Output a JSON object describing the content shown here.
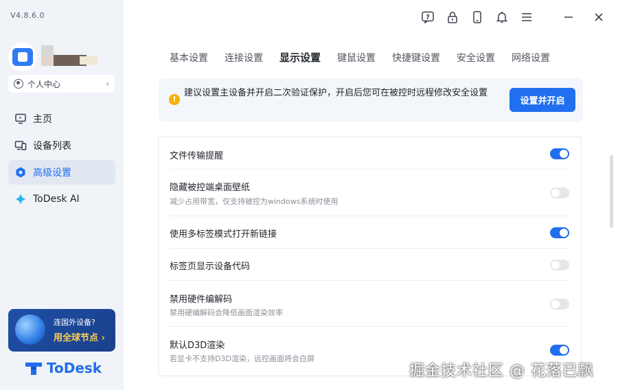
{
  "app": {
    "version": "V4.8.6.0",
    "brand": "ToDesk"
  },
  "sidebar": {
    "personal_center": "个人中心",
    "items": [
      {
        "label": "主页",
        "icon": "monitor-home-icon"
      },
      {
        "label": "设备列表",
        "icon": "devices-icon"
      },
      {
        "label": "高级设置",
        "icon": "gear-icon"
      },
      {
        "label": "ToDesk AI",
        "icon": "sparkle-icon"
      }
    ],
    "active_index": 2,
    "promo": {
      "line1": "连国外设备?",
      "line2": "用全球节点"
    }
  },
  "topbar": {
    "icons": [
      "help-icon",
      "lock-icon",
      "phone-icon",
      "bell-icon",
      "menu-icon"
    ],
    "window_controls": [
      "minimize-icon",
      "close-icon"
    ]
  },
  "tabs": [
    {
      "label": "基本设置"
    },
    {
      "label": "连接设置"
    },
    {
      "label": "显示设置"
    },
    {
      "label": "键鼠设置"
    },
    {
      "label": "快捷键设置"
    },
    {
      "label": "安全设置"
    },
    {
      "label": "网络设置"
    }
  ],
  "active_tab": "显示设置",
  "banner": {
    "text": "建议设置主设备并开启二次验证保护，开启后您可在被控时远程修改安全设置",
    "button": "设置并开启"
  },
  "settings": [
    {
      "title": "文件传输提醒",
      "desc": "",
      "enabled": true
    },
    {
      "title": "隐藏被控端桌面壁纸",
      "desc": "减少占用带宽，仅支持被控为windows系统时使用",
      "enabled": false
    },
    {
      "title": "使用多标签模式打开新链接",
      "desc": "",
      "enabled": true
    },
    {
      "title": "标签页显示设备代码",
      "desc": "",
      "enabled": false
    },
    {
      "title": "禁用硬件编解码",
      "desc": "禁用硬编解码会降低画面渲染效率",
      "enabled": false
    },
    {
      "title": "默认D3D渲染",
      "desc": "若显卡不支持D3D渲染，远控画面将会白屏",
      "enabled": true
    }
  ],
  "watermark": "掘金技术社区 @ 花落已飘",
  "colors": {
    "accent": "#1f6fee",
    "sidebar_bg": "#f0f3f8",
    "warning": "#f5b400",
    "promo_highlight": "#ffd24a"
  }
}
